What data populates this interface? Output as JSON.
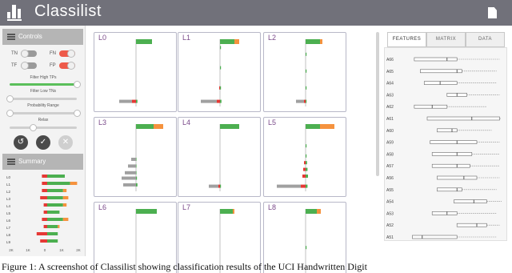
{
  "app": {
    "title": "Classilist"
  },
  "controls": {
    "header": "Controls",
    "toggles": [
      {
        "label": "TN",
        "state": "off"
      },
      {
        "label": "FN",
        "state": "on"
      },
      {
        "label": "TF",
        "state": "off"
      },
      {
        "label": "FP",
        "state": "on"
      }
    ],
    "sliders": [
      {
        "label": "Filter High TPs",
        "value": 1.0,
        "color": "#5bbf5b"
      },
      {
        "label": "Filter Low TNs",
        "value": 0.0,
        "color": "#cfcfcf"
      },
      {
        "label": "Probability Range",
        "value": 1.0,
        "color": "#cfcfcf"
      },
      {
        "label": "Relax",
        "value": 0.35,
        "color": "#cfcfcf"
      }
    ]
  },
  "summary": {
    "header": "Summary",
    "rows": [
      {
        "label": "L0",
        "red": 3,
        "green": 10,
        "orange": 0
      },
      {
        "label": "L1",
        "red": 3,
        "green": 13,
        "orange": 4
      },
      {
        "label": "L2",
        "red": 3,
        "green": 9,
        "orange": 2
      },
      {
        "label": "L3",
        "red": 4,
        "green": 9,
        "orange": 3
      },
      {
        "label": "L4",
        "red": 2,
        "green": 9,
        "orange": 2
      },
      {
        "label": "L5",
        "red": 2,
        "green": 7,
        "orange": 0
      },
      {
        "label": "L6",
        "red": 3,
        "green": 9,
        "orange": 3
      },
      {
        "label": "L7",
        "red": 2,
        "green": 6,
        "orange": 1
      },
      {
        "label": "L8",
        "red": 6,
        "green": 6,
        "orange": 0
      },
      {
        "label": "L9",
        "red": 4,
        "green": 6,
        "orange": 0
      }
    ],
    "ticks": [
      "2K",
      "1K",
      "0",
      "1K",
      "2K"
    ]
  },
  "cards": [
    {
      "title": "L0",
      "green": 20,
      "orange": 0,
      "bins": [
        [
          0.9,
          16,
          5,
          3
        ]
      ]
    },
    {
      "title": "L1",
      "green": 18,
      "orange": 6,
      "bins": [
        [
          0.1,
          0,
          0,
          2
        ],
        [
          0.4,
          0,
          0,
          2
        ],
        [
          0.7,
          0,
          1,
          2
        ],
        [
          0.9,
          20,
          4,
          3
        ]
      ]
    },
    {
      "title": "L2",
      "green": 18,
      "orange": 3,
      "bins": [
        [
          0.2,
          0,
          0,
          2
        ],
        [
          0.45,
          0,
          0,
          2
        ],
        [
          0.7,
          0,
          0,
          2
        ],
        [
          0.9,
          10,
          2,
          2
        ]
      ]
    },
    {
      "title": "L3",
      "green": 22,
      "orange": 12,
      "bins": [
        [
          0.5,
          6,
          0,
          1
        ],
        [
          0.6,
          10,
          0,
          1
        ],
        [
          0.7,
          14,
          0,
          1
        ],
        [
          0.78,
          18,
          0,
          2
        ],
        [
          0.88,
          16,
          0,
          3
        ]
      ]
    },
    {
      "title": "L4",
      "green": 24,
      "orange": 0,
      "bins": [
        [
          0.9,
          12,
          2,
          2
        ]
      ]
    },
    {
      "title": "L5",
      "green": 18,
      "orange": 18,
      "bins": [
        [
          0.3,
          0,
          0,
          2
        ],
        [
          0.45,
          0,
          0,
          2
        ],
        [
          0.55,
          0,
          2,
          3
        ],
        [
          0.65,
          0,
          3,
          4
        ],
        [
          0.75,
          0,
          4,
          5
        ],
        [
          0.9,
          30,
          6,
          4
        ]
      ]
    },
    {
      "title": "L6",
      "green": 26,
      "orange": 0,
      "bins": []
    },
    {
      "title": "L7",
      "green": 16,
      "orange": 2,
      "bins": []
    },
    {
      "title": "L8",
      "green": 14,
      "orange": 5,
      "bins": [
        [
          0.55,
          0,
          0,
          2
        ]
      ]
    }
  ],
  "tabs": [
    "FEATURES",
    "MATRIX",
    "DATA"
  ],
  "features": [
    {
      "name": "A66",
      "q1": 0.12,
      "med": 0.45,
      "q3": 0.55,
      "max": 0.98
    },
    {
      "name": "A65",
      "q1": 0.18,
      "med": 0.55,
      "q3": 0.6,
      "max": 0.95
    },
    {
      "name": "A64",
      "q1": 0.22,
      "med": 0.38,
      "q3": 0.55,
      "max": 0.95
    },
    {
      "name": "A63",
      "q1": 0.45,
      "med": 0.55,
      "q3": 0.65,
      "max": 0.98
    },
    {
      "name": "A62",
      "q1": 0.12,
      "med": 0.3,
      "q3": 0.45,
      "max": 0.85
    },
    {
      "name": "A61",
      "q1": 0.25,
      "med": 0.7,
      "q3": 0.98,
      "max": 1.0
    },
    {
      "name": "A60",
      "q1": 0.35,
      "med": 0.5,
      "q3": 0.55,
      "max": 0.9
    },
    {
      "name": "A59",
      "q1": 0.28,
      "med": 0.55,
      "q3": 0.75,
      "max": 0.98
    },
    {
      "name": "A58",
      "q1": 0.3,
      "med": 0.55,
      "q3": 0.7,
      "max": 0.98
    },
    {
      "name": "A57",
      "q1": 0.3,
      "med": 0.55,
      "q3": 0.68,
      "max": 0.98
    },
    {
      "name": "A56",
      "q1": 0.35,
      "med": 0.62,
      "q3": 0.75,
      "max": 0.98
    },
    {
      "name": "A55",
      "q1": 0.35,
      "med": 0.55,
      "q3": 0.6,
      "max": 0.95
    },
    {
      "name": "A54",
      "q1": 0.52,
      "med": 0.72,
      "q3": 0.85,
      "max": 1.0
    },
    {
      "name": "A53",
      "q1": 0.3,
      "med": 0.45,
      "q3": 0.55,
      "max": 0.95
    },
    {
      "name": "A52",
      "q1": 0.55,
      "med": 0.75,
      "q3": 0.85,
      "max": 0.98
    },
    {
      "name": "A51",
      "q1": 0.1,
      "med": 0.2,
      "q3": 0.55,
      "max": 0.95
    }
  ],
  "caption": "Figure 1: A screenshot of Classilist showing classification results of the UCI Handwritten Digit"
}
